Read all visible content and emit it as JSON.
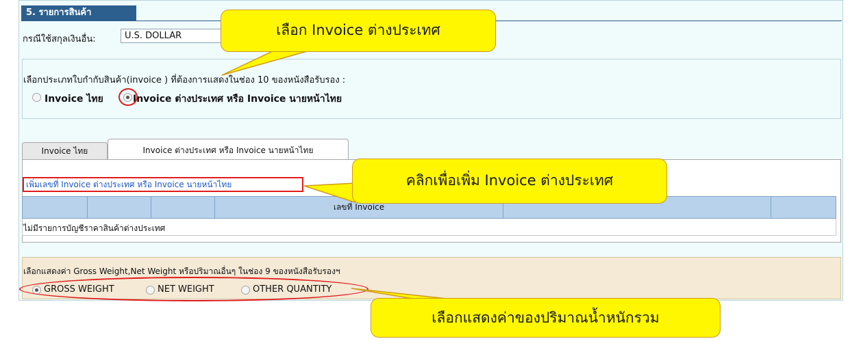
{
  "section": {
    "title": "5. รายการสินค้า"
  },
  "currency": {
    "label": "กรณีใช้สกุลเงินอื่น:",
    "value": "U.S. DOLLAR"
  },
  "invoice_type": {
    "question": "เลือกประเภทใบกำกับสินค้า(invoice ) ที่ต้องการแสดงในช่อง 10 ของหนังสือรับรอง :",
    "options": [
      {
        "label": "Invoice ไทย",
        "selected": false
      },
      {
        "label": "Invoice ต่างประเทศ หรือ Invoice นายหน้าไทย",
        "selected": true
      }
    ]
  },
  "tabs": [
    {
      "label": "Invoice ไทย",
      "active": false
    },
    {
      "label": "Invoice ต่างประเทศ หรือ Invoice นายหน้าไทย",
      "active": true
    }
  ],
  "foreign_invoice": {
    "add_link": "เพิ่มเลขที่ Invoice ต่างประเทศ หรือ Invoice นายหน้าไทย",
    "columns": [
      "",
      "",
      "",
      "เลขที่ Invoice",
      "",
      ""
    ],
    "empty_message": "ไม่มีรายการบัญชีราคาสินค้าต่างประเทศ"
  },
  "weight": {
    "question": "เลือกแสดงค่า Gross Weight,Net Weight หรือปริมาณอื่นๆ ในช่อง 9 ของหนังสือรับรองฯ",
    "options": [
      {
        "label": "GROSS WEIGHT",
        "selected": true
      },
      {
        "label": "NET WEIGHT",
        "selected": false
      },
      {
        "label": "OTHER QUANTITY",
        "selected": false
      }
    ]
  },
  "callouts": {
    "select_foreign": "เลือก Invoice ต่างประเทศ",
    "click_add": "คลิกเพื่อเพิ่ม Invoice ต่างประเทศ",
    "select_weight": "เลือกแสดงค่าของปริมาณน้ำหนักรวม"
  },
  "colors": {
    "callout_fill": "#fff700",
    "highlight": "#e01c1c",
    "section_tab": "#2d5f8e"
  }
}
